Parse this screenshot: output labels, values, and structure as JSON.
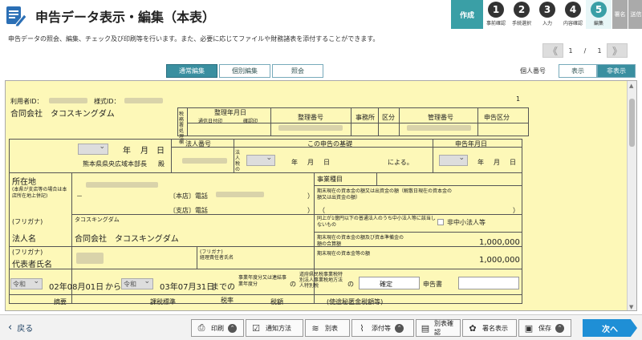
{
  "header": {
    "title": "申告データ表示・編集（本表）",
    "steps": {
      "create": "作成",
      "items": [
        {
          "num": "1",
          "label": "事前確認"
        },
        {
          "num": "2",
          "label": "手続選択"
        },
        {
          "num": "3",
          "label": "入力"
        },
        {
          "num": "4",
          "label": "内容確認"
        },
        {
          "num": "5",
          "label": "編集"
        }
      ],
      "sign": "署名",
      "send": "送信"
    }
  },
  "description": "申告データの照会、編集、チェック及び印刷等を行います。また、必要に応じてファイルや財務諸表を添付することができます。",
  "pager": {
    "current": "1",
    "sep": "/",
    "total": "1",
    "first": "《",
    "last": "》"
  },
  "view_tabs": [
    "通常編集",
    "個別編集",
    "照会"
  ],
  "kojin": {
    "label": "個人番号",
    "show": "表示",
    "hide": "非表示"
  },
  "form": {
    "user_id_label": "利用者ID：",
    "form_id_label": "様式ID：",
    "page_mark": "1",
    "company_top": "合同会社　タコスキングダム",
    "receipt_label": "整理年月日",
    "notice_label": "通信日付印",
    "confirm_label": "確認印",
    "seiri_bango": "整理番号",
    "jimusho": "事務所",
    "kubun": "区分",
    "kanri_bango": "管理番号",
    "shinkoku_kubun": "申告区分",
    "zeimusho_label": "税務署処理欄",
    "year": "年",
    "month": "月",
    "day": "日",
    "houjin_bango": "法人番号",
    "kono_shinkoku": "この申告の基礎",
    "shinkoku_ym": "申告年月日",
    "houjin_zei": "法人税の",
    "yoru": "による。",
    "address_to": "熊本県県央広域本部長",
    "dono": "殿",
    "shozaichi": "所在地",
    "shozaichi_note": "(本県が支店等の場合は本店所在地上併記)",
    "honten_tel": "〔本店〕電話",
    "shiten_tel": "〔支店〕電話",
    "dash": "－",
    "jigyo_shumoku": "事業種目",
    "shihon_label": "期末現在の資本金の額又は出資金の額（解散日現在の資本金の額又は出資金の額）",
    "paren_open": "（",
    "paren_close": "）",
    "furigana": "(フリガナ)",
    "furigana_value": "タコスキングダム",
    "houjin_mei": "法人名",
    "houjin_mei_value": "合同会社　タコスキングダム",
    "chusho_label": "同上が1億円以下の普通法人のうち中小法人等に該当しないもの",
    "chusho_check": "非中小法人等",
    "shihon_junbi": "期末現在の資本金の額及び資本準備金の額の合算額",
    "amount1": "1,000,000",
    "daihyo_furigana": "(フリガナ)",
    "daihyo": "代表者氏名",
    "keiri_furigana": "(フリガナ)",
    "keiri": "経理責任者氏名",
    "shihon_tou": "期末現在の資本金等の額",
    "amount2": "1,000,000",
    "era1": "令和",
    "date_from": "02年08月01日",
    "kara": "から",
    "era2": "令和",
    "date_to": "03年07月31日",
    "made": "までの",
    "nendo_label": "事業年度分又は連結事業年度分",
    "no": "の",
    "zei_label": "道府県民税事業税特別法人事業税地方法人特別税",
    "kakutei": "確定",
    "shinkokusho": "申告書",
    "tekiyo": "摘要",
    "kazei_hyojun": "課税標準",
    "zeiritsu": "税率",
    "zeigaku": "税額",
    "shiwake": "(使途秘匿金税額等)"
  },
  "bottom": {
    "back": "戻る",
    "print": "印刷",
    "notice": "通知方法",
    "beppyo": "別表",
    "attach": "添付等",
    "beppyo_check": "別表確認",
    "sign_show": "署名表示",
    "save": "保存",
    "next": "次へ"
  }
}
